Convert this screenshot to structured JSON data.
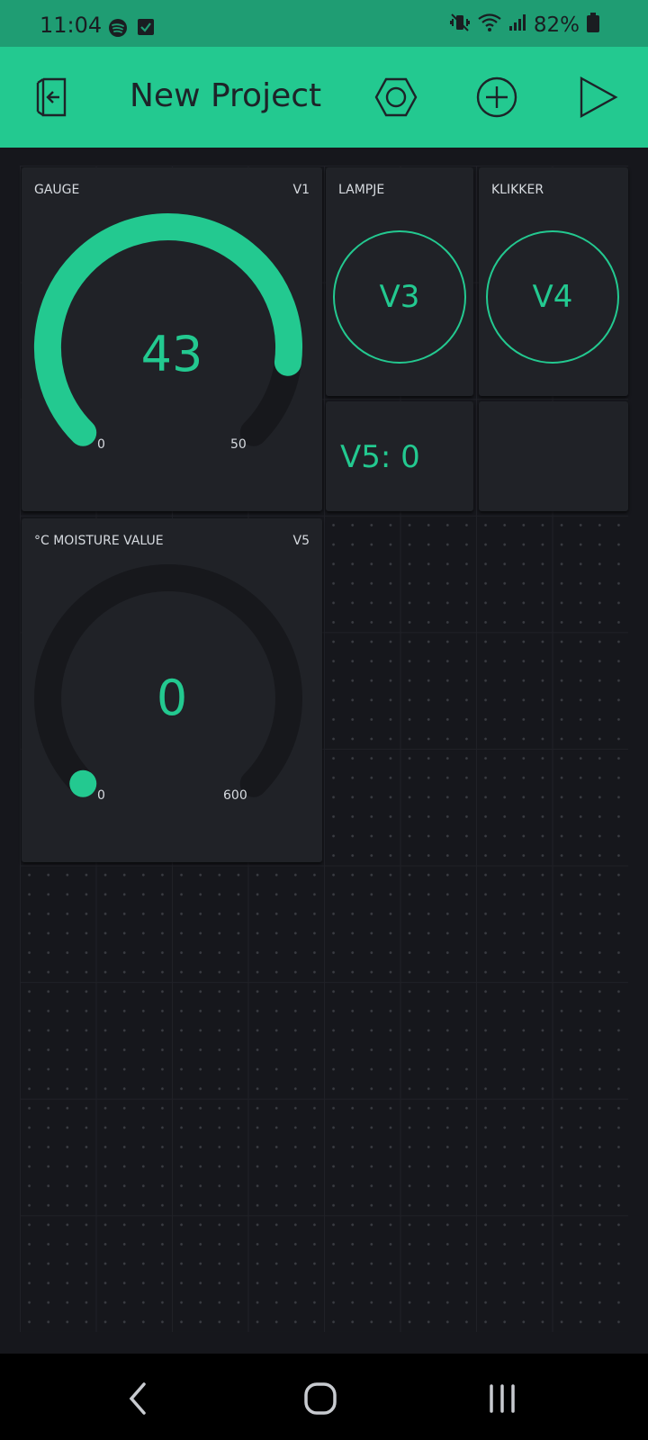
{
  "status_bar": {
    "time": "11:04",
    "battery": "82%",
    "icons": [
      "spotify-icon",
      "checkbox-icon",
      "mute-vibrate-icon",
      "wifi-icon",
      "signal-icon",
      "battery-icon"
    ]
  },
  "app_bar": {
    "title": "New Project",
    "icons": [
      "exit-project-icon",
      "settings-hexagon-icon",
      "add-widget-icon",
      "play-icon"
    ]
  },
  "widgets": {
    "gauge1": {
      "label": "GAUGE",
      "pin": "V1",
      "value": "43",
      "min": "0",
      "max": "50",
      "level": 43,
      "range": [
        0,
        50
      ]
    },
    "lampje": {
      "label": "LAMPJE",
      "button_text": "V3"
    },
    "klikker": {
      "label": "KLIKKER",
      "button_text": "V4"
    },
    "value_display": {
      "text": "V5: 0"
    },
    "gauge2": {
      "label": "°C MOISTURE VALUE",
      "pin": "V5",
      "value": "0",
      "min": "0",
      "max": "600",
      "level": 0,
      "range": [
        0,
        600
      ]
    }
  },
  "colors": {
    "accent": "#23c990",
    "status_bar": "#1f9d73",
    "background": "#16171c",
    "widget_bg": "#202227",
    "gauge_track": "#17181c"
  },
  "nav_bar": {
    "icons": [
      "back-icon",
      "home-icon",
      "recents-icon"
    ]
  }
}
